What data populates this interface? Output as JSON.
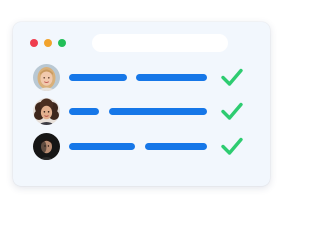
{
  "window": {
    "traffic_lights": [
      {
        "name": "close",
        "color": "#ef3d4e"
      },
      {
        "name": "minimize",
        "color": "#f2a32c"
      },
      {
        "name": "maximize",
        "color": "#23bf58"
      }
    ],
    "address_bar_text": ""
  },
  "colors": {
    "window_background": "#f2f7fd",
    "text_bar": "#1677e8",
    "check": "#2ecc71"
  },
  "rows": [
    {
      "avatar": "avatar-woman-blonde",
      "status_icon": "check-icon"
    },
    {
      "avatar": "avatar-woman-curly-dark-hair",
      "status_icon": "check-icon"
    },
    {
      "avatar": "avatar-man-dark-background",
      "status_icon": "check-icon"
    }
  ]
}
